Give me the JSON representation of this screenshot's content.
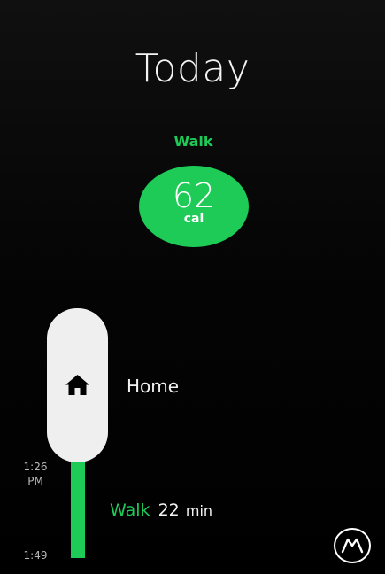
{
  "page": {
    "title": "Today"
  },
  "summary": {
    "activity_label": "Walk",
    "value": "62",
    "unit": "cal"
  },
  "timeline": {
    "place": {
      "name": "Home",
      "icon": "home-icon"
    },
    "start_time": "1:26\nPM",
    "end_time": "1:49",
    "activity": {
      "name": "Walk",
      "duration": "22",
      "duration_unit": "min"
    }
  },
  "app_button": {
    "icon": "moves-logo-icon"
  },
  "colors": {
    "accent": "#1ecb56",
    "background": "#000000",
    "place_pill": "#efefef",
    "text": "#ffffff",
    "muted_text": "#b9b9b9"
  }
}
